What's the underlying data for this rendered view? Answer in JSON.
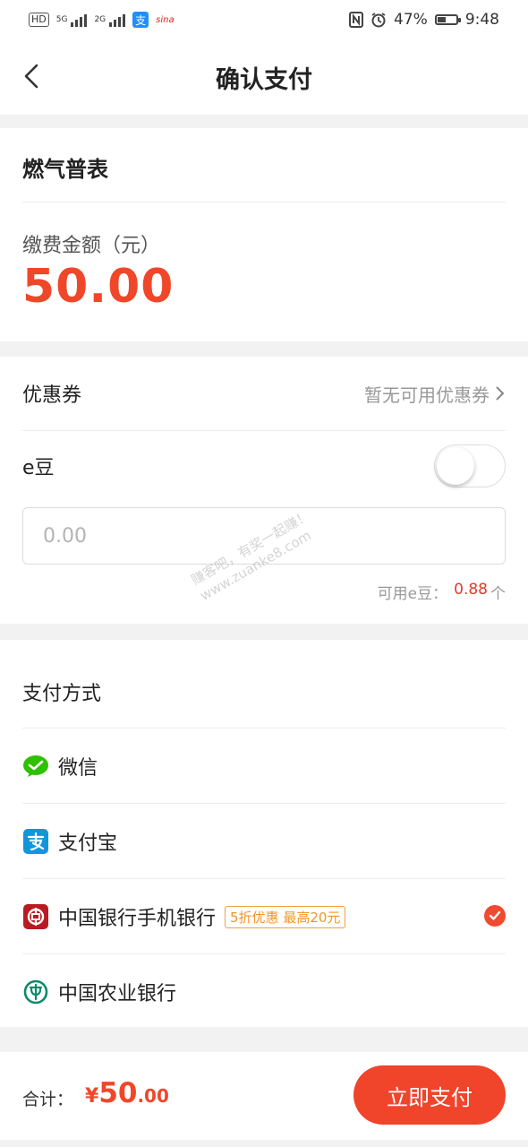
{
  "status_bar": {
    "left": {
      "hd": "HD",
      "sig1_tag": "5G",
      "sig2_tag": "2G",
      "alipay_glyph": "支",
      "weibo": "sina"
    },
    "battery_percent": "47%",
    "battery_level": 0.47,
    "time": "9:48"
  },
  "nav": {
    "title": "确认支付"
  },
  "service": {
    "name": "燃气普表"
  },
  "payment": {
    "amount_label": "缴费金额（元）",
    "amount": "50.00"
  },
  "coupon": {
    "label": "优惠券",
    "value": "暂无可用优惠券"
  },
  "edou": {
    "label": "e豆",
    "toggle_on": false,
    "input_placeholder": "0.00",
    "available_prefix": "可用e豆：",
    "available_value": "0.88",
    "available_unit": "个"
  },
  "methods": {
    "title": "支付方式",
    "items": [
      {
        "label": "微信",
        "icon": "wechat-icon",
        "selected": false
      },
      {
        "label": "支付宝",
        "icon": "alipay-icon",
        "selected": false
      },
      {
        "label": "中国银行手机银行",
        "icon": "boc-icon",
        "promo": "5折优惠 最高20元",
        "selected": true
      },
      {
        "label": "中国农业银行",
        "icon": "abc-icon",
        "selected": false
      }
    ]
  },
  "footer": {
    "total_label": "合计：",
    "currency": "¥",
    "total_int": "50",
    "total_dec": ".00",
    "pay_button": "立即支付"
  },
  "watermark": {
    "line1": "赚客吧，有奖一起赚！",
    "line2": "www.zuanke8.com"
  },
  "colors": {
    "accent": "#f0472a",
    "promo": "#f0962a",
    "wechat": "#2dc100",
    "alipay": "#1296db",
    "boc": "#b81c22",
    "abc": "#0b8a6c"
  }
}
